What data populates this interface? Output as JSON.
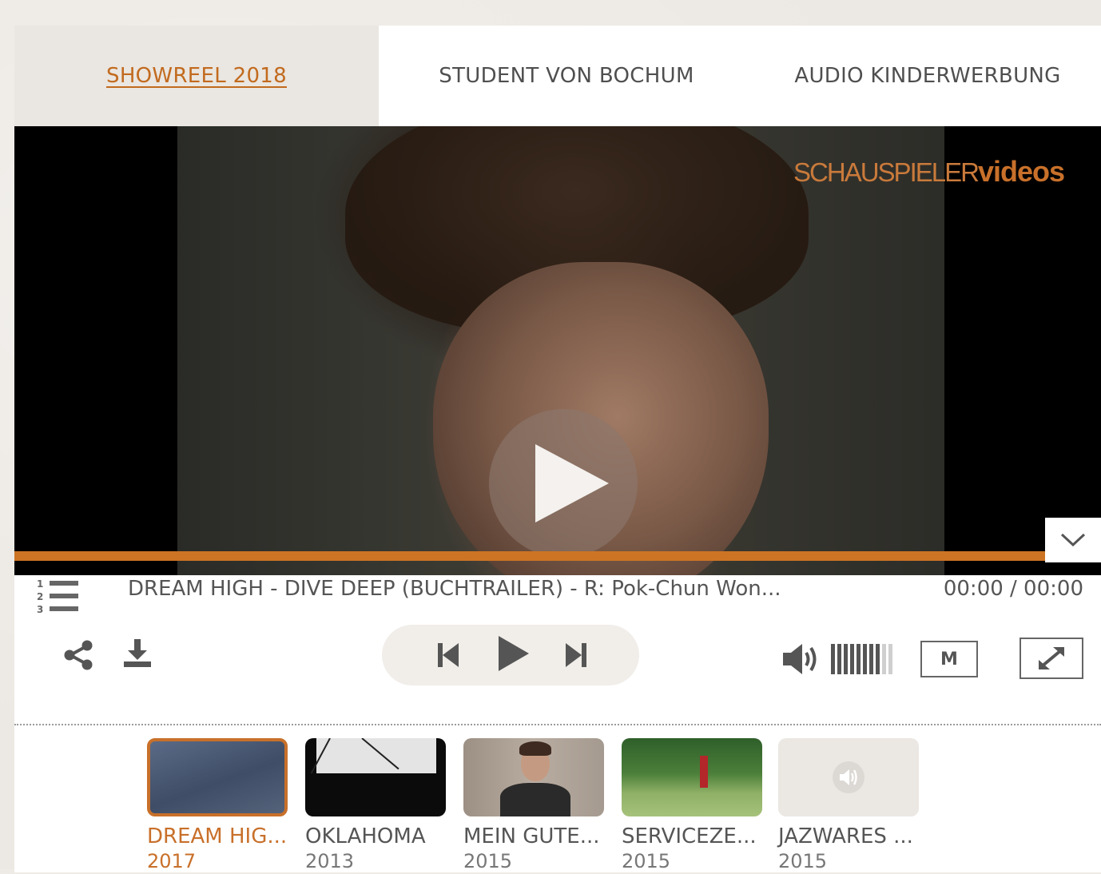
{
  "tabs": [
    {
      "label": "SHOWREEL 2018",
      "active": true
    },
    {
      "label": "STUDENT VON BOCHUM",
      "active": false
    },
    {
      "label": "AUDIO KINDERWERBUNG",
      "active": false
    }
  ],
  "player": {
    "watermark_bold": "SCHAUSPIELER",
    "watermark_light": "videos",
    "title": "DREAM HIGH - DIVE DEEP (BUCHTRAILER) - R: Pok-Chun Won...",
    "time": "00:00 / 00:00",
    "progress_fraction": 0.0,
    "mute_label": "M",
    "volume_level": 0.8
  },
  "icons": {
    "playlist": "playlist-icon",
    "share": "share-icon",
    "download": "download-icon",
    "prev": "skip-previous-icon",
    "play": "play-icon",
    "next": "skip-next-icon",
    "volume": "volume-icon",
    "fullscreen": "fullscreen-icon",
    "collapse": "chevron-down-icon"
  },
  "colors": {
    "accent": "#c8702a",
    "text": "#555555",
    "tab_active_bg": "#eae6e1"
  },
  "thumbnails": [
    {
      "label": "DREAM HIG...",
      "year": "2017",
      "active": true
    },
    {
      "label": "OKLAHOMA",
      "year": "2013",
      "active": false
    },
    {
      "label": "MEIN GUTE...",
      "year": "2015",
      "active": false
    },
    {
      "label": "SERVICEZE...",
      "year": "2015",
      "active": false
    },
    {
      "label": "JAZWARES ...",
      "year": "2015",
      "active": false
    }
  ]
}
